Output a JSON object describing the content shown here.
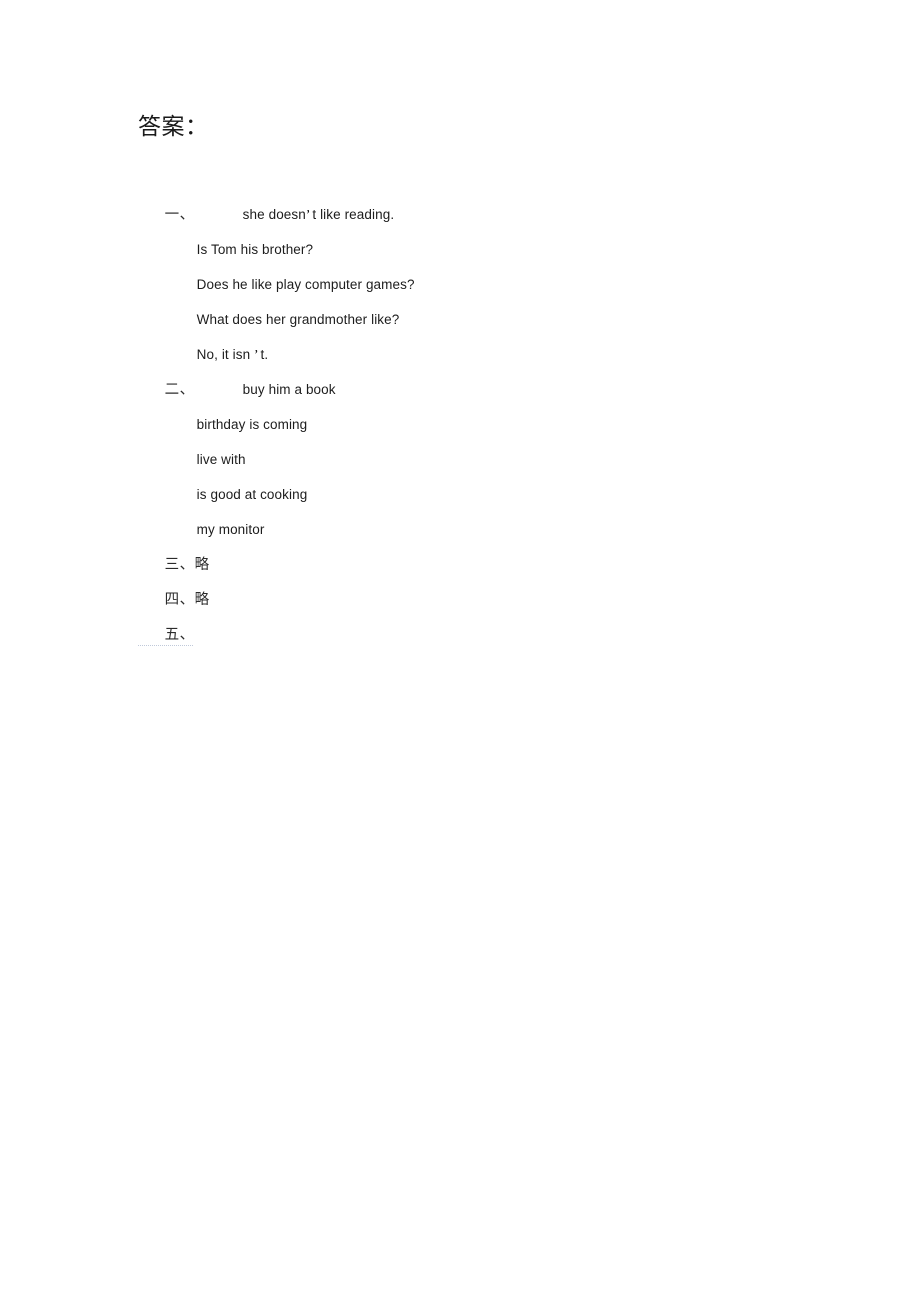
{
  "document": {
    "title": "答案：",
    "page_background": "#ffffff",
    "text_color": "#1d1d1d",
    "marker_color": "#2b2b2b",
    "dotted_rule_color": "#9aa9c4"
  },
  "sections": [
    {
      "marker": "一、",
      "first_line": {
        "before_apostrophe": "she doesn",
        "apostrophe": "’",
        "after_apostrophe": "t like reading."
      },
      "lines": [
        "Is Tom his brother?",
        "Does he like play computer games?",
        "What does her grandmother like?"
      ],
      "last_line": {
        "before_apostrophe": "No, it isn ",
        "apostrophe": "’",
        "after_apostrophe": "t."
      }
    },
    {
      "marker": "二、",
      "first_line_text": "buy him a book",
      "lines": [
        "birthday is coming",
        "live with",
        "is good at cooking",
        "my monitor"
      ]
    },
    {
      "marker": "三、",
      "body": "略"
    },
    {
      "marker": "四、",
      "body": "略"
    },
    {
      "marker": "五、",
      "body": ""
    }
  ]
}
